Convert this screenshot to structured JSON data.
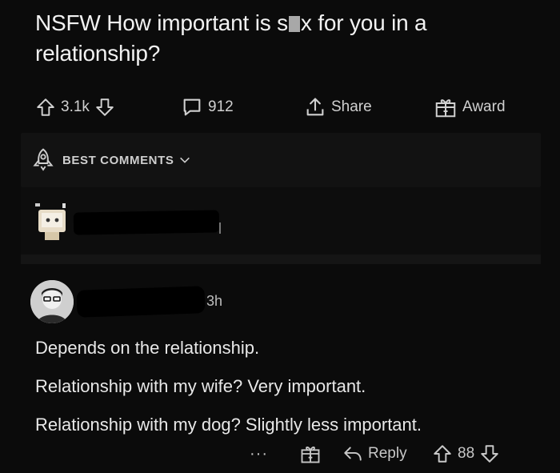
{
  "post": {
    "title_part1": "NSFW How important is s",
    "title_part2": "x for you in a relationship?",
    "upvotes": "3.1k",
    "comments": "912",
    "share_label": "Share",
    "award_label": "Award"
  },
  "sort": {
    "label": "BEST COMMENTS"
  },
  "comment": {
    "time": "3h",
    "lines": [
      "Depends on the relationship.",
      "Relationship with my wife? Very important.",
      "Relationship with my dog? Slightly less important."
    ],
    "more_label": "···",
    "reply_label": "Reply",
    "score": "88"
  },
  "icons": {
    "upvote": "arrow-up-icon",
    "downvote": "arrow-down-icon",
    "comment": "speech-bubble-icon",
    "share": "share-icon",
    "award": "gift-icon",
    "sort": "rocket-icon",
    "chevron": "chevron-down-icon",
    "reply": "reply-arrow-icon"
  }
}
